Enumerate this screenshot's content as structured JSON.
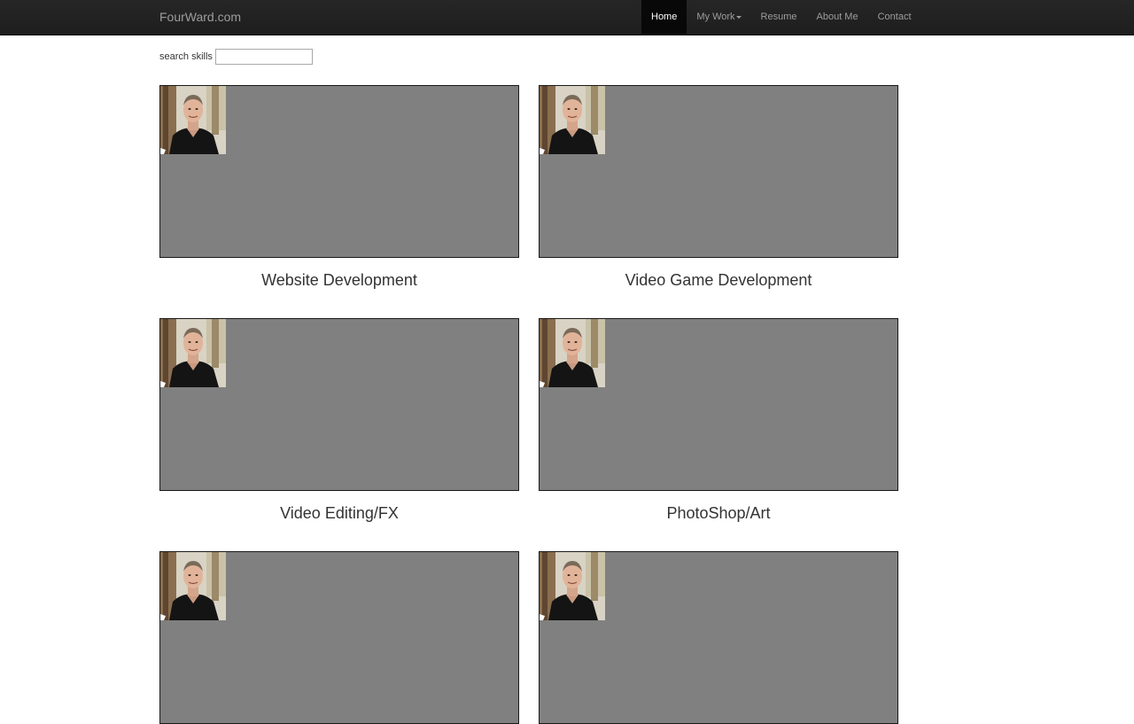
{
  "brand": "FourWard.com",
  "nav": {
    "home": "Home",
    "my_work": "My Work",
    "resume": "Resume",
    "about": "About Me",
    "contact": "Contact"
  },
  "search": {
    "label": "search skills",
    "value": ""
  },
  "cards": [
    {
      "title": "Website Development"
    },
    {
      "title": "Video Game Development"
    },
    {
      "title": "Video Editing/FX"
    },
    {
      "title": "PhotoShop/Art"
    },
    {
      "title": ""
    },
    {
      "title": ""
    }
  ],
  "colors": {
    "navbar": "#222222",
    "card_bg": "#808080"
  }
}
